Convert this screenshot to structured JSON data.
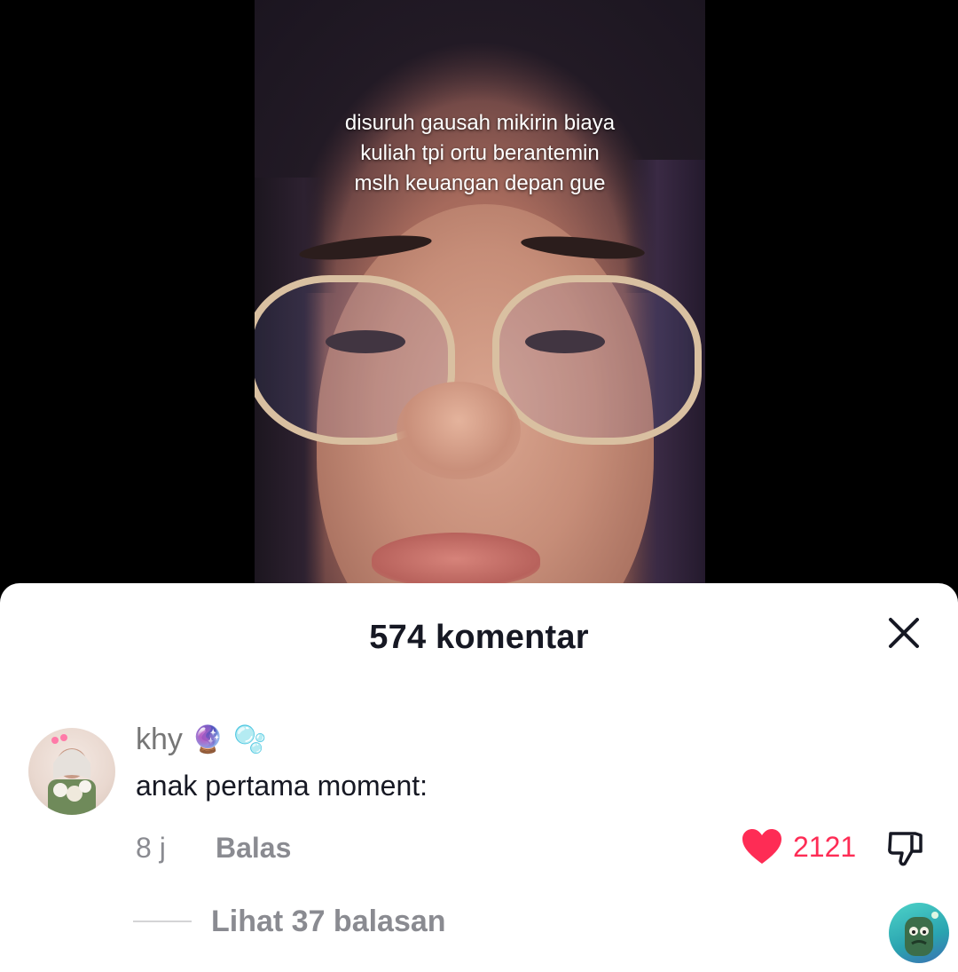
{
  "video": {
    "caption_lines": [
      "disuruh gausah mikirin biaya",
      "kuliah tpi ortu berantemin",
      "mslh keuangan depan gue"
    ]
  },
  "comments_sheet": {
    "title": "574 komentar",
    "close_icon": "close-icon",
    "comment": {
      "username": "khy",
      "username_emojis": [
        "🔮",
        "🫧"
      ],
      "text": "anak pertama moment:",
      "time": "8 j",
      "reply_label": "Balas",
      "like_count": "2121",
      "like_icon": "heart-icon",
      "dislike_icon": "thumbs-down-icon",
      "view_replies": "Lihat 37 balasan"
    }
  },
  "colors": {
    "accent": "#fe2c55",
    "text_primary": "#161823",
    "text_secondary": "#8a8b91"
  }
}
